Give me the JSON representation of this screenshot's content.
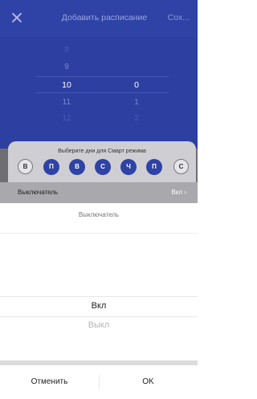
{
  "header": {
    "title": "Добавить расписание",
    "save_label": "Сох..."
  },
  "time_picker": {
    "hours": [
      "9",
      "10",
      "11",
      "12"
    ],
    "minutes": [
      "0",
      "1",
      "2"
    ],
    "selected_hour": "10",
    "selected_minute": "0"
  },
  "smart_mode": {
    "title": "Выберите дни для Смарт режима",
    "days": [
      "В",
      "П",
      "В",
      "С",
      "Ч",
      "П",
      "С"
    ]
  },
  "switch_row": {
    "label": "Выключатель",
    "value": "Вкл"
  },
  "sheet": {
    "title": "Выключатель",
    "options": [
      "Вкл",
      "Выкл"
    ],
    "cancel_label": "Отменить",
    "ok_label": "OK"
  },
  "colors": {
    "primary": "#2f42a6",
    "overlay": "#6e6e72"
  }
}
